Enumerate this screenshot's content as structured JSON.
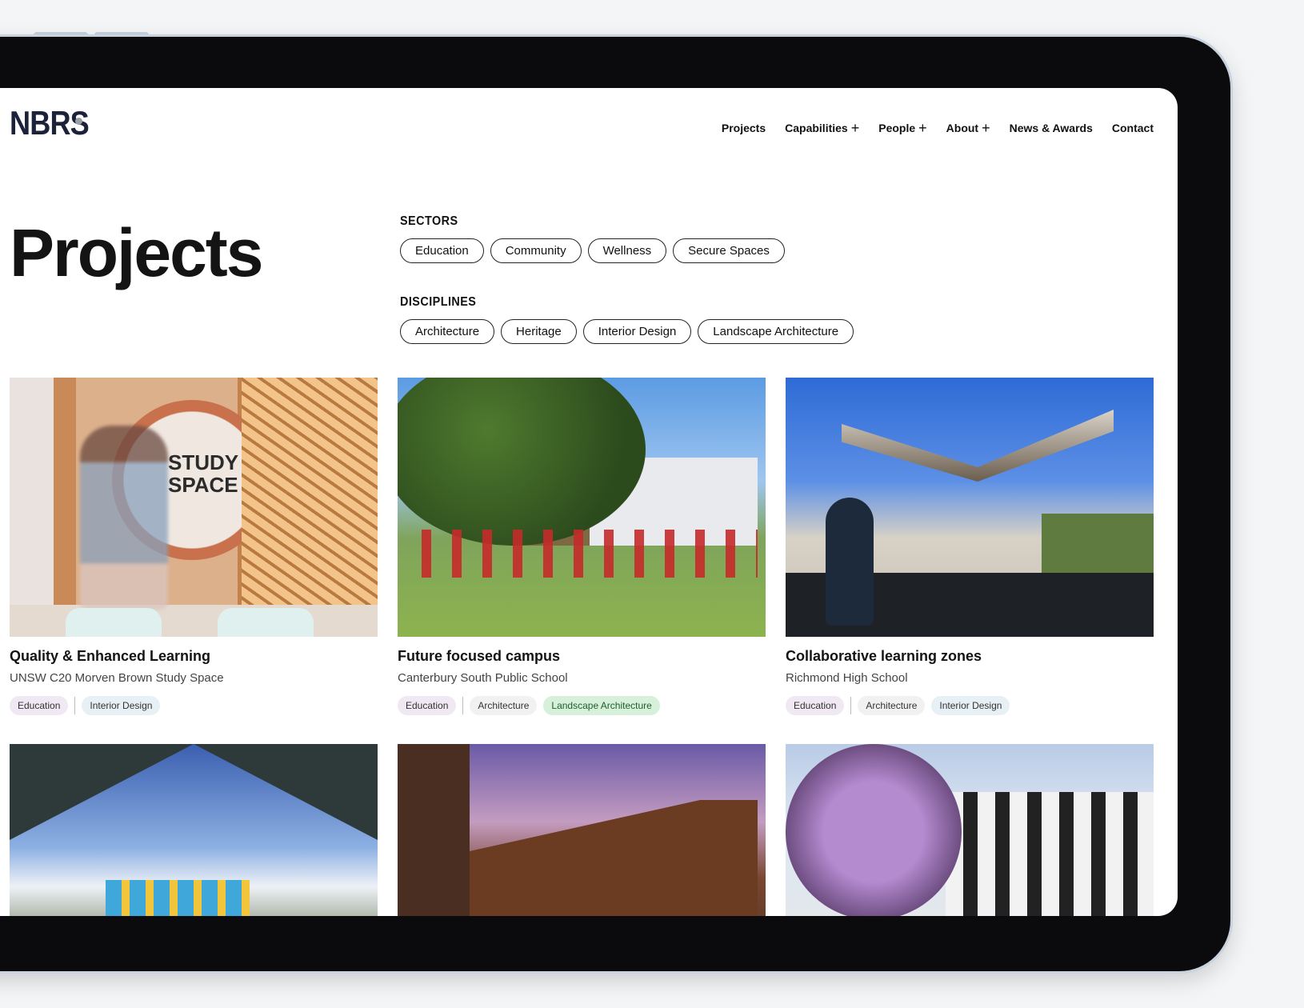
{
  "nav": {
    "logo": "NBRS",
    "items": [
      {
        "label": "Projects",
        "plus": ""
      },
      {
        "label": "Capabilities",
        "plus": "+"
      },
      {
        "label": "People",
        "plus": "+"
      },
      {
        "label": "About",
        "plus": "+"
      },
      {
        "label": "News & Awards",
        "plus": ""
      },
      {
        "label": "Contact",
        "plus": ""
      }
    ]
  },
  "page": {
    "title": "Projects"
  },
  "filters": {
    "sectors": {
      "label": "SECTORS",
      "chips": [
        "Education",
        "Community",
        "Wellness",
        "Secure Spaces"
      ]
    },
    "disciplines": {
      "label": "DISCIPLINES",
      "chips": [
        "Architecture",
        "Heritage",
        "Interior Design",
        "Landscape Architecture"
      ]
    }
  },
  "projects": [
    {
      "title": "Quality & Enhanced Learning",
      "subtitle": "UNSW C20 Morven Brown Study Space",
      "image_text_1": "STUDY",
      "image_text_2": "SPACE",
      "tags": [
        {
          "label": "Education"
        },
        {
          "label": "Interior Design"
        }
      ]
    },
    {
      "title": "Future focused campus",
      "subtitle": "Canterbury South Public School",
      "tags": [
        {
          "label": "Education"
        },
        {
          "label": "Architecture"
        },
        {
          "label": "Landscape Architecture"
        }
      ]
    },
    {
      "title": "Collaborative learning zones",
      "subtitle": "Richmond High School",
      "tags": [
        {
          "label": "Education"
        },
        {
          "label": "Architecture"
        },
        {
          "label": "Interior Design"
        }
      ]
    }
  ],
  "colors": {
    "brand": "#1c2238",
    "tag_education": "#f0e8f3",
    "tag_architecture": "#f1f1f1",
    "tag_interior": "#e7f0f5",
    "tag_landscape": "#d6f0da"
  }
}
